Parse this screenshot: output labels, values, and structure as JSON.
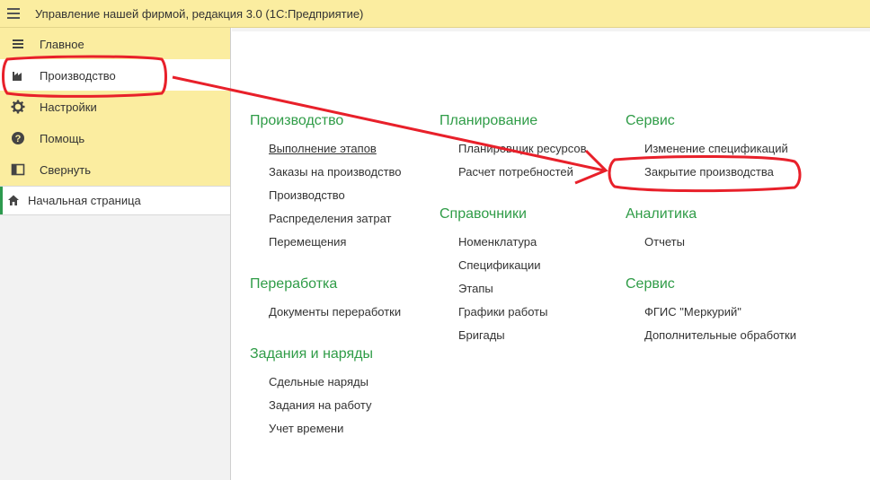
{
  "app": {
    "title": "Управление нашей фирмой, редакция 3.0  (1С:Предприятие)"
  },
  "sidebar": {
    "items": [
      {
        "label": "Главное",
        "icon": "list-icon"
      },
      {
        "label": "Производство",
        "icon": "factory-icon"
      },
      {
        "label": "Настройки",
        "icon": "gear-icon"
      },
      {
        "label": "Помощь",
        "icon": "help-icon"
      },
      {
        "label": "Свернуть",
        "icon": "collapse-icon"
      }
    ],
    "home": {
      "label": "Начальная страница",
      "icon": "home-icon"
    }
  },
  "sections": {
    "production": {
      "title": "Производство",
      "links": [
        "Выполнение этапов",
        "Заказы на производство",
        "Производство",
        "Распределения затрат",
        "Перемещения"
      ]
    },
    "processing": {
      "title": "Переработка",
      "links": [
        "Документы переработки"
      ]
    },
    "tasks": {
      "title": "Задания и наряды",
      "links": [
        "Сдельные наряды",
        "Задания на работу",
        "Учет времени"
      ]
    },
    "planning": {
      "title": "Планирование",
      "links": [
        "Планировщик ресурсов",
        "Расчет потребностей"
      ]
    },
    "catalogs": {
      "title": "Справочники",
      "links": [
        "Номенклатура",
        "Спецификации",
        "Этапы",
        "Графики работы",
        "Бригады"
      ]
    },
    "service": {
      "title": "Сервис",
      "links": [
        "Изменение спецификаций",
        "Закрытие производства"
      ]
    },
    "analytics": {
      "title": "Аналитика",
      "links": [
        "Отчеты"
      ]
    },
    "service2": {
      "title": "Сервис",
      "links": [
        "ФГИС \"Меркурий\"",
        "Дополнительные обработки"
      ]
    }
  },
  "colors": {
    "accent_green": "#2f9c47",
    "panel_yellow": "#fbeda0",
    "annotation_red": "#e8202a"
  }
}
